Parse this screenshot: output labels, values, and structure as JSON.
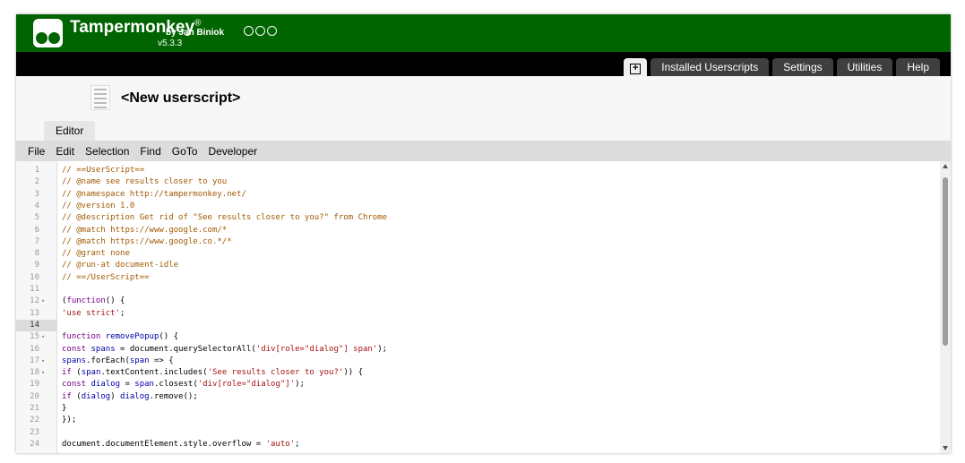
{
  "header": {
    "app_name": "Tampermonkey",
    "registered": "®",
    "byline": "by Jan Biniok",
    "version": "v5.3.3",
    "social_icons": [
      "github-icon",
      "facebook-icon",
      "instagram-icon"
    ],
    "bg_color": "#006400"
  },
  "nav": {
    "new_tab_icon": "plus-box-icon",
    "new_tab_glyph": "+",
    "tabs": [
      "Installed Userscripts",
      "Settings",
      "Utilities",
      "Help"
    ]
  },
  "script": {
    "title": "<New userscript>"
  },
  "editor_tab": "Editor",
  "menu": [
    "File",
    "Edit",
    "Selection",
    "Find",
    "GoTo",
    "Developer"
  ],
  "editor": {
    "active_line": 14,
    "lines": [
      {
        "n": "1",
        "fold": false,
        "text": "// ==UserScript=="
      },
      {
        "n": "2",
        "fold": false,
        "text": "// @name see results closer to you"
      },
      {
        "n": "3",
        "fold": false,
        "text": "// @namespace http://tampermonkey.net/"
      },
      {
        "n": "4",
        "fold": false,
        "text": "// @version 1.0"
      },
      {
        "n": "5",
        "fold": false,
        "text": "// @description Get rid of \"See results closer to you?\" from Chrome"
      },
      {
        "n": "6",
        "fold": false,
        "text": "// @match https://www.google.com/*"
      },
      {
        "n": "7",
        "fold": false,
        "text": "// @match https://www.google.co.*/*"
      },
      {
        "n": "8",
        "fold": false,
        "text": "// @grant none"
      },
      {
        "n": "9",
        "fold": false,
        "text": "// @run-at document-idle"
      },
      {
        "n": "10",
        "fold": false,
        "text": "// ==/UserScript=="
      },
      {
        "n": "11",
        "fold": false,
        "text": ""
      },
      {
        "n": "12",
        "fold": true,
        "text": "(function() {"
      },
      {
        "n": "13",
        "fold": false,
        "text": "'use strict';"
      },
      {
        "n": "14",
        "fold": false,
        "text": ""
      },
      {
        "n": "15",
        "fold": true,
        "text": "function removePopup() {"
      },
      {
        "n": "16",
        "fold": false,
        "text": "const spans = document.querySelectorAll('div[role=\"dialog\"] span');"
      },
      {
        "n": "17",
        "fold": true,
        "text": "spans.forEach(span => {"
      },
      {
        "n": "18",
        "fold": true,
        "text": "if (span.textContent.includes('See results closer to you?')) {"
      },
      {
        "n": "19",
        "fold": false,
        "text": "const dialog = span.closest('div[role=\"dialog\"]');"
      },
      {
        "n": "20",
        "fold": false,
        "text": "if (dialog) dialog.remove();"
      },
      {
        "n": "21",
        "fold": false,
        "text": "}"
      },
      {
        "n": "22",
        "fold": false,
        "text": "});"
      },
      {
        "n": "23",
        "fold": false,
        "text": ""
      },
      {
        "n": "24",
        "fold": false,
        "text": "document.documentElement.style.overflow = 'auto';"
      }
    ]
  }
}
